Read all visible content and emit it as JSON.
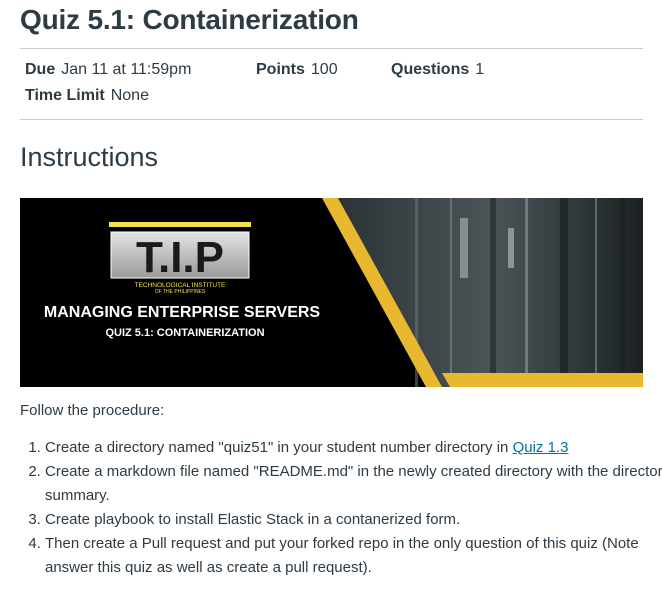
{
  "page": {
    "title": "Quiz 5.1: Containerization"
  },
  "details": {
    "due_label": "Due",
    "due_value": "Jan 11 at 11:59pm",
    "points_label": "Points",
    "points_value": "100",
    "questions_label": "Questions",
    "questions_value": "1",
    "time_limit_label": "Time Limit",
    "time_limit_value": "None"
  },
  "instructions": {
    "heading": "Instructions",
    "banner": {
      "logo_text": "T.I.P",
      "institute_line1": "TECHNOLOGICAL INSTITUTE",
      "institute_line2": "OF THE PHILIPPINES",
      "course_title": "MANAGING ENTERPRISE SERVERS",
      "quiz_subtitle": "QUIZ 5.1: CONTAINERIZATION",
      "accent_color": "#e8b930"
    },
    "lead": "Follow the procedure:",
    "steps": [
      {
        "text": "Create a directory named \"quiz51\" in your student number directory in ",
        "link": "Quiz 1.3"
      },
      {
        "text": "Create a markdown file named \"README.md\" in the newly created directory with the directory summary."
      },
      {
        "text": "Create playbook to install Elastic Stack in a contanerized form."
      },
      {
        "text": "Then create a Pull request and put your forked repo in the only question of this quiz (Note answer this quiz as well as create a pull request)."
      }
    ]
  },
  "colors": {
    "text": "#2d3b45",
    "link": "#0770a3",
    "divider": "#c7cdd1"
  }
}
